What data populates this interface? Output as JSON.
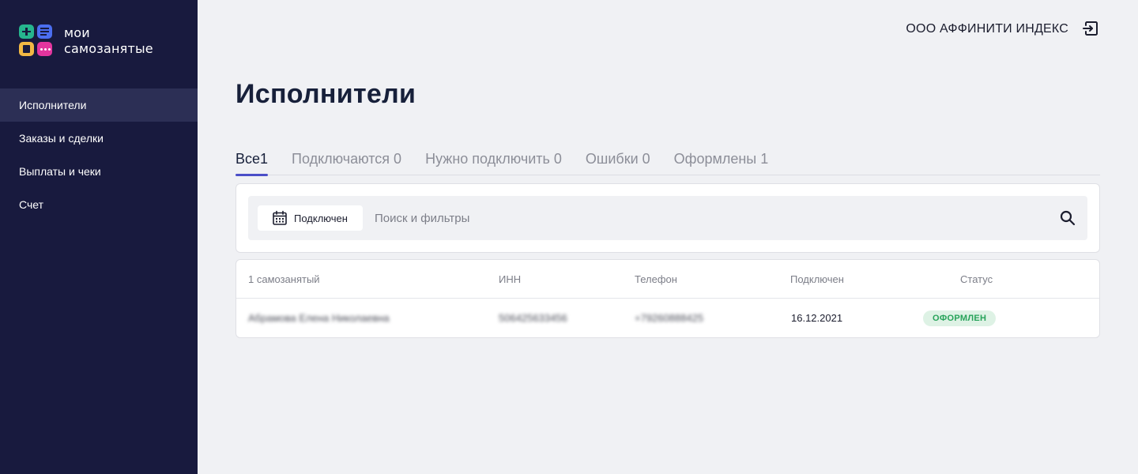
{
  "app": {
    "logo_line1": "мои",
    "logo_line2": "самозанятые"
  },
  "sidebar": {
    "items": [
      {
        "label": "Исполнители",
        "active": true
      },
      {
        "label": "Заказы и сделки",
        "active": false
      },
      {
        "label": "Выплаты и чеки",
        "active": false
      },
      {
        "label": "Счет",
        "active": false
      }
    ]
  },
  "header": {
    "company": "ООО АФФИНИТИ ИНДЕКС",
    "logout_icon": "logout-icon"
  },
  "page": {
    "title": "Исполнители"
  },
  "tabs": [
    {
      "label": "Все1",
      "active": true
    },
    {
      "label": "Подключаются 0",
      "active": false
    },
    {
      "label": "Нужно подключить 0",
      "active": false
    },
    {
      "label": "Ошибки 0",
      "active": false
    },
    {
      "label": "Оформлены 1",
      "active": false
    }
  ],
  "filters": {
    "date_chip_label": "Подключен",
    "date_chip_icon": "calendar-icon",
    "search_placeholder": "Поиск и фильтры",
    "search_value": "",
    "search_icon": "search-icon"
  },
  "table": {
    "columns": [
      "1 самозанятый",
      "ИНН",
      "Телефон",
      "Подключен",
      "Статус"
    ],
    "rows": [
      {
        "name": "Абрамова Елена Николаевна",
        "inn": "506425633456",
        "phone": "+79260888425",
        "connected": "16.12.2021",
        "status": "ОФОРМЛЕН"
      }
    ]
  },
  "colors": {
    "sidebar_bg": "#181a3e",
    "sidebar_active": "#2c2f55",
    "accent": "#4b4fc8",
    "status_green": "#27a35a",
    "status_green_bg": "#def2e5"
  }
}
